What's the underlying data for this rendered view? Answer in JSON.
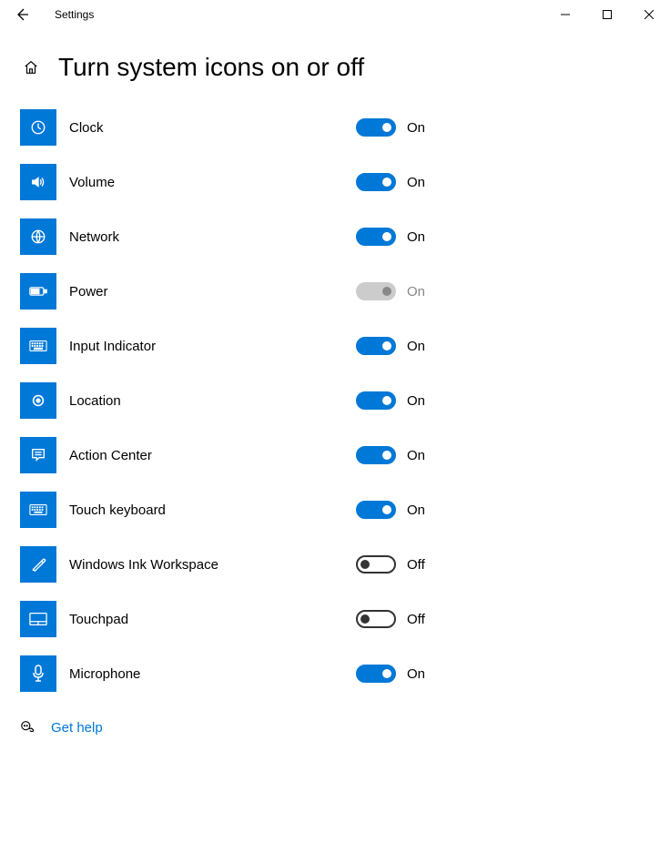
{
  "window": {
    "app_title": "Settings",
    "page_title": "Turn system icons on or off"
  },
  "toggle_labels": {
    "on": "On",
    "off": "Off"
  },
  "items": [
    {
      "id": "clock",
      "label": "Clock",
      "state": "on"
    },
    {
      "id": "volume",
      "label": "Volume",
      "state": "on"
    },
    {
      "id": "network",
      "label": "Network",
      "state": "on"
    },
    {
      "id": "power",
      "label": "Power",
      "state": "disabled"
    },
    {
      "id": "input",
      "label": "Input Indicator",
      "state": "on"
    },
    {
      "id": "location",
      "label": "Location",
      "state": "on"
    },
    {
      "id": "action",
      "label": "Action Center",
      "state": "on"
    },
    {
      "id": "touchkb",
      "label": "Touch keyboard",
      "state": "on"
    },
    {
      "id": "ink",
      "label": "Windows Ink Workspace",
      "state": "off"
    },
    {
      "id": "touchpad",
      "label": "Touchpad",
      "state": "off"
    },
    {
      "id": "microphone",
      "label": "Microphone",
      "state": "on"
    }
  ],
  "help": {
    "label": "Get help"
  }
}
